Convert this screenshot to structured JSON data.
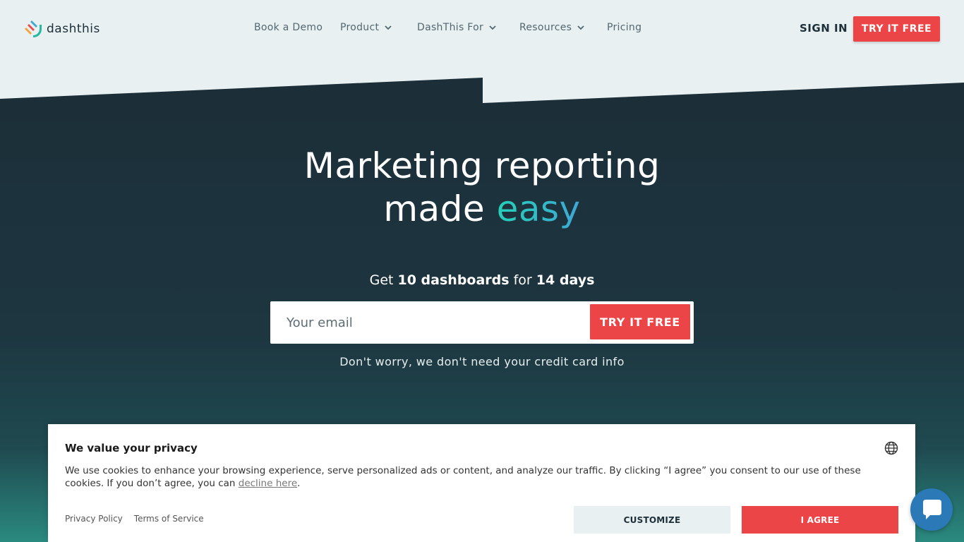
{
  "brand": {
    "name": "dashthis"
  },
  "nav": {
    "items": [
      {
        "label": "Book a Demo",
        "dropdown": false
      },
      {
        "label": "Product",
        "dropdown": true
      },
      {
        "label": "DashThis For",
        "dropdown": true
      },
      {
        "label": "Resources",
        "dropdown": true
      },
      {
        "label": "Pricing",
        "dropdown": false
      }
    ],
    "sign_in": "SIGN IN",
    "try_free": "TRY IT FREE"
  },
  "hero": {
    "title_line1": "Marketing reporting",
    "title_line2_pre": "made ",
    "title_line2_accent": "easy",
    "offer_pre": "Get ",
    "offer_bold1": "10 dashboards",
    "offer_mid": " for ",
    "offer_bold2": "14 days",
    "email_placeholder": "Your email",
    "email_value": "",
    "cta": "TRY IT FREE",
    "note": "Don't worry, we don't need your credit card info"
  },
  "cookie": {
    "title": "We value your privacy",
    "text_pre": "We use cookies to enhance your browsing experience, serve personalized ads or content, and analyze our traffic. By clicking “I agree” you consent to our use of these cookies. If you don’t agree, you can ",
    "decline_link": "decline here",
    "text_post": ".",
    "privacy_policy": "Privacy Policy",
    "terms": "Terms of Service",
    "customize": "CUSTOMIZE",
    "agree": "I AGREE"
  },
  "icons": {
    "logo": "dashthis-logo-icon",
    "globe": "globe-icon",
    "chevron": "chevron-down-icon",
    "chat": "chat-bubble-icon"
  },
  "colors": {
    "accent_red": "#ec4548",
    "hero_dark": "#1d2f38",
    "header_bg": "#e8f0f2",
    "chat_blue": "#2b79b6"
  }
}
